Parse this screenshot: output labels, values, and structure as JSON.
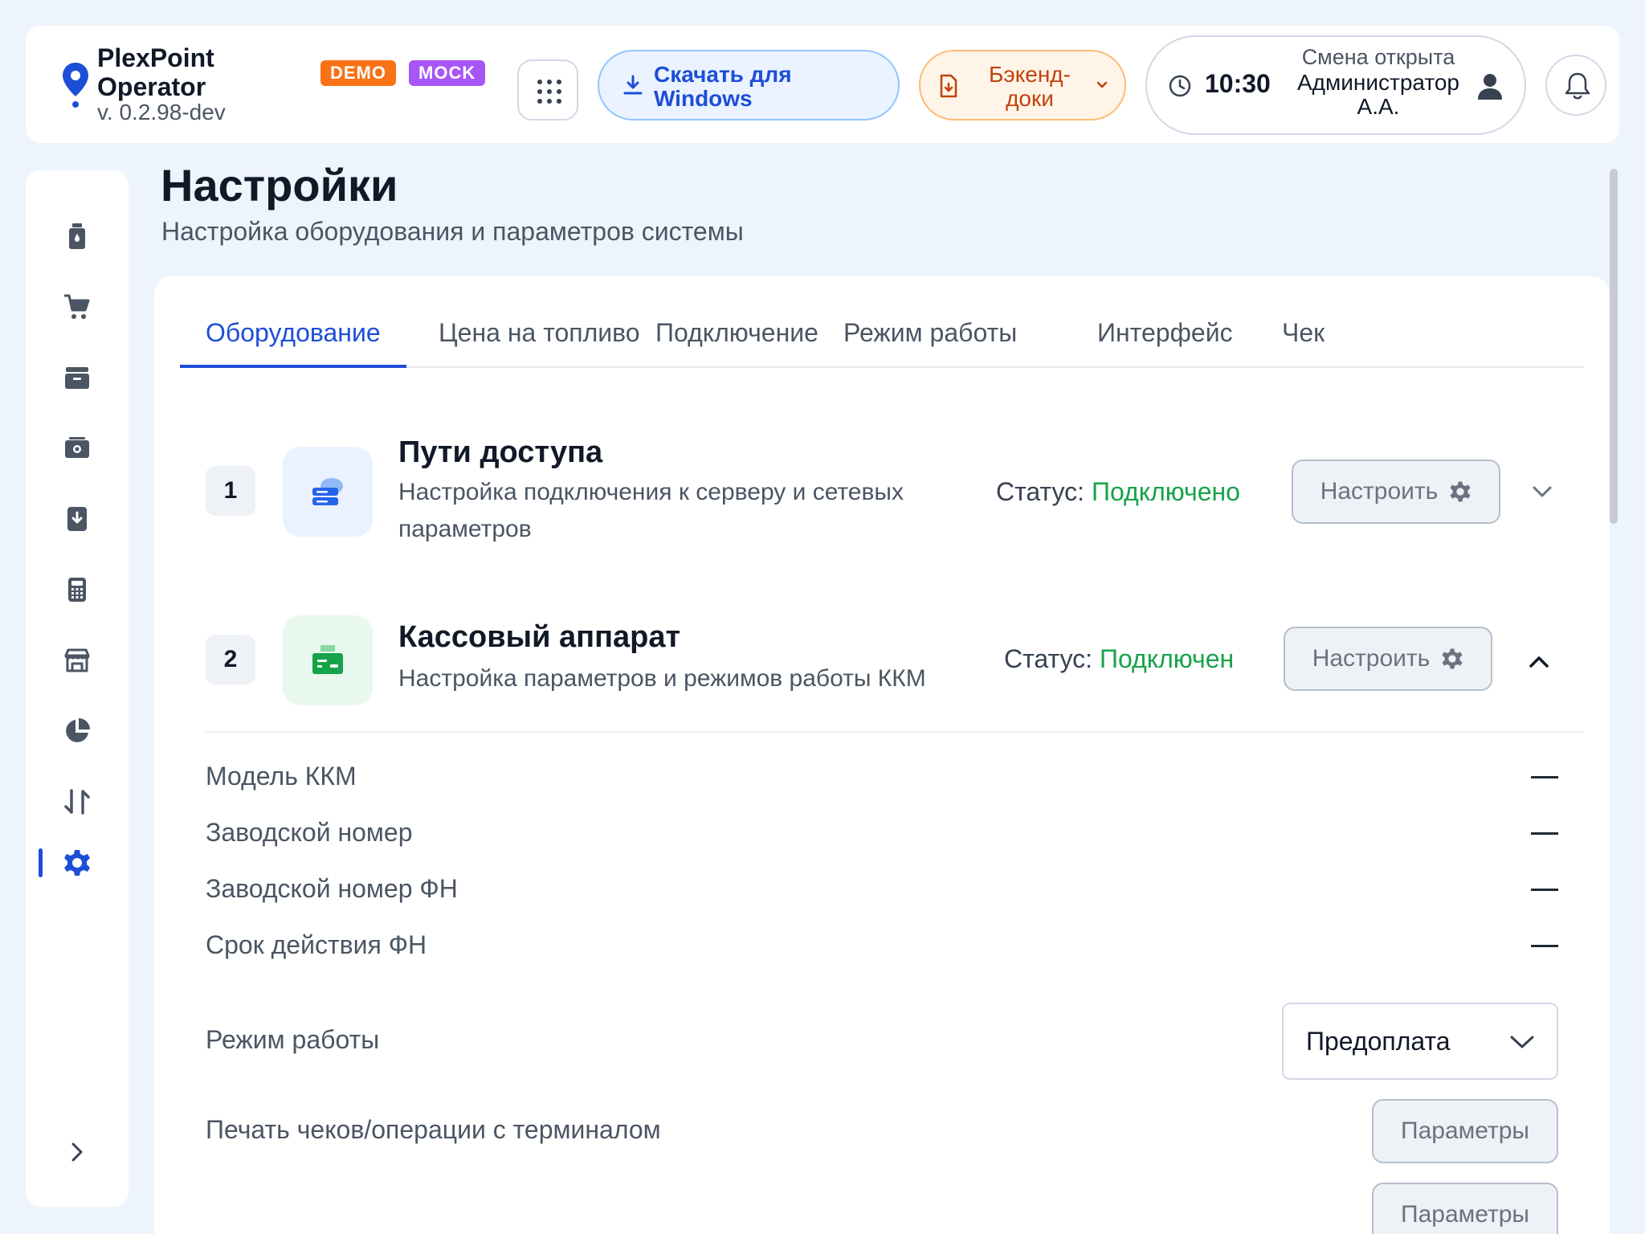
{
  "header": {
    "brand_line1": "PlexPoint",
    "brand_line2": "Operator",
    "version": "v. 0.2.98-dev",
    "badge_demo": "DEMO",
    "badge_mock": "MOCK",
    "download_label": "Скачать для Windows",
    "docs_label": "Бэкенд-доки",
    "time": "10:30",
    "shift_status": "Смена открыта",
    "user_name": "Администратор А.А."
  },
  "sidebar": {
    "items": [
      {
        "icon": "fuel-can-icon"
      },
      {
        "icon": "cart-icon"
      },
      {
        "icon": "inbox-icon"
      },
      {
        "icon": "cash-register-icon"
      },
      {
        "icon": "download-file-icon"
      },
      {
        "icon": "calculator-icon"
      },
      {
        "icon": "store-icon"
      },
      {
        "icon": "pie-chart-icon"
      },
      {
        "icon": "transfer-icon"
      },
      {
        "icon": "gear-icon",
        "active": true
      }
    ]
  },
  "page": {
    "title": "Настройки",
    "subtitle": "Настройка оборудования и параметров системы"
  },
  "tabs": [
    {
      "label": "Оборудование",
      "active": true
    },
    {
      "label": "Цена на топливо"
    },
    {
      "label": "Подключение"
    },
    {
      "label": "Режим работы"
    },
    {
      "label": "Интерфейс"
    },
    {
      "label": "Чек"
    }
  ],
  "equipment": [
    {
      "num": "1",
      "title": "Пути доступа",
      "description": "Настройка подключения к серверу и сетевых параметров",
      "status_label": "Статус:",
      "status_value": "Подключено",
      "button": "Настроить",
      "expanded": false
    },
    {
      "num": "2",
      "title": "Кассовый аппарат",
      "description": "Настройка параметров и режимов работы ККМ",
      "status_label": "Статус:",
      "status_value": "Подключен",
      "button": "Настроить",
      "expanded": true
    }
  ],
  "kkm_details": {
    "model_label": "Модель ККМ",
    "serial_label": "Заводской номер",
    "fn_serial_label": "Заводской номер ФН",
    "fn_expiry_label": "Срок действия ФН",
    "mode_label": "Режим работы",
    "mode_value": "Предоплата",
    "print_label": "Печать чеков/операции с терминалом",
    "params_button": "Параметры"
  },
  "colors": {
    "accent": "#1d4ed8",
    "status_ok": "#16a34a",
    "demo_badge": "#f97316",
    "mock_badge": "#a855f7"
  }
}
